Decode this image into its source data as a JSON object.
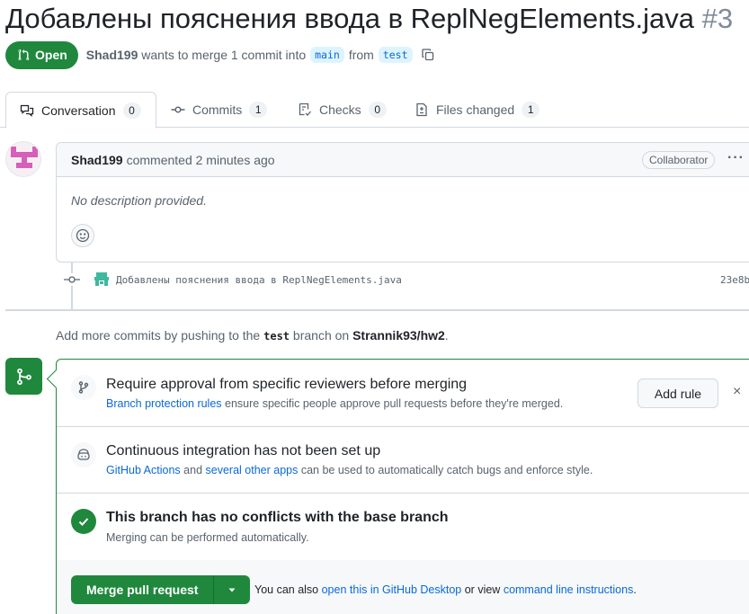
{
  "pr": {
    "title": "Добавлены пояснения ввода в ReplNegElements.java",
    "number": "#3",
    "state_label": "Open",
    "author": "Shad199",
    "merge_text": "wants to merge 1 commit into",
    "base_branch": "main",
    "from_text": "from",
    "head_branch": "test"
  },
  "tabs": [
    {
      "label": "Conversation",
      "count": "0",
      "icon": "comment-discussion-icon"
    },
    {
      "label": "Commits",
      "count": "1",
      "icon": "git-commit-icon"
    },
    {
      "label": "Checks",
      "count": "0",
      "icon": "checklist-icon"
    },
    {
      "label": "Files changed",
      "count": "1",
      "icon": "file-diff-icon"
    }
  ],
  "comment": {
    "author": "Shad199",
    "meta": "commented 2 minutes ago",
    "role_badge": "Collaborator",
    "kebab": "···",
    "body": "No description provided."
  },
  "commit": {
    "message": "Добавлены пояснения ввода в ReplNegElements.java",
    "sha": "23e8b"
  },
  "hint": {
    "prefix": "Add more commits by pushing to the",
    "branch": "test",
    "middle": "branch on",
    "repo": "Strannik93/hw2",
    "suffix": "."
  },
  "merge_box": {
    "protection": {
      "title": "Require approval from specific reviewers before merging",
      "link": "Branch protection rules",
      "text": "ensure specific people approve pull requests before they're merged.",
      "button": "Add rule",
      "close": "×"
    },
    "ci": {
      "title": "Continuous integration has not been set up",
      "link1": "GitHub Actions",
      "and": "and",
      "link2": "several other apps",
      "text": "can be used to automatically catch bugs and enforce style."
    },
    "conflicts": {
      "title": "This branch has no conflicts with the base branch",
      "subtitle": "Merging can be performed automatically."
    },
    "footer": {
      "merge_button": "Merge pull request",
      "note_prefix": "You can also",
      "link1": "open this in GitHub Desktop",
      "note_mid": "or view",
      "link2": "command line instructions",
      "note_suffix": "."
    }
  },
  "colors": {
    "accent_green": "#1f883d",
    "link_blue": "#0969da",
    "muted": "#59636e",
    "border": "#d1d9e0"
  }
}
